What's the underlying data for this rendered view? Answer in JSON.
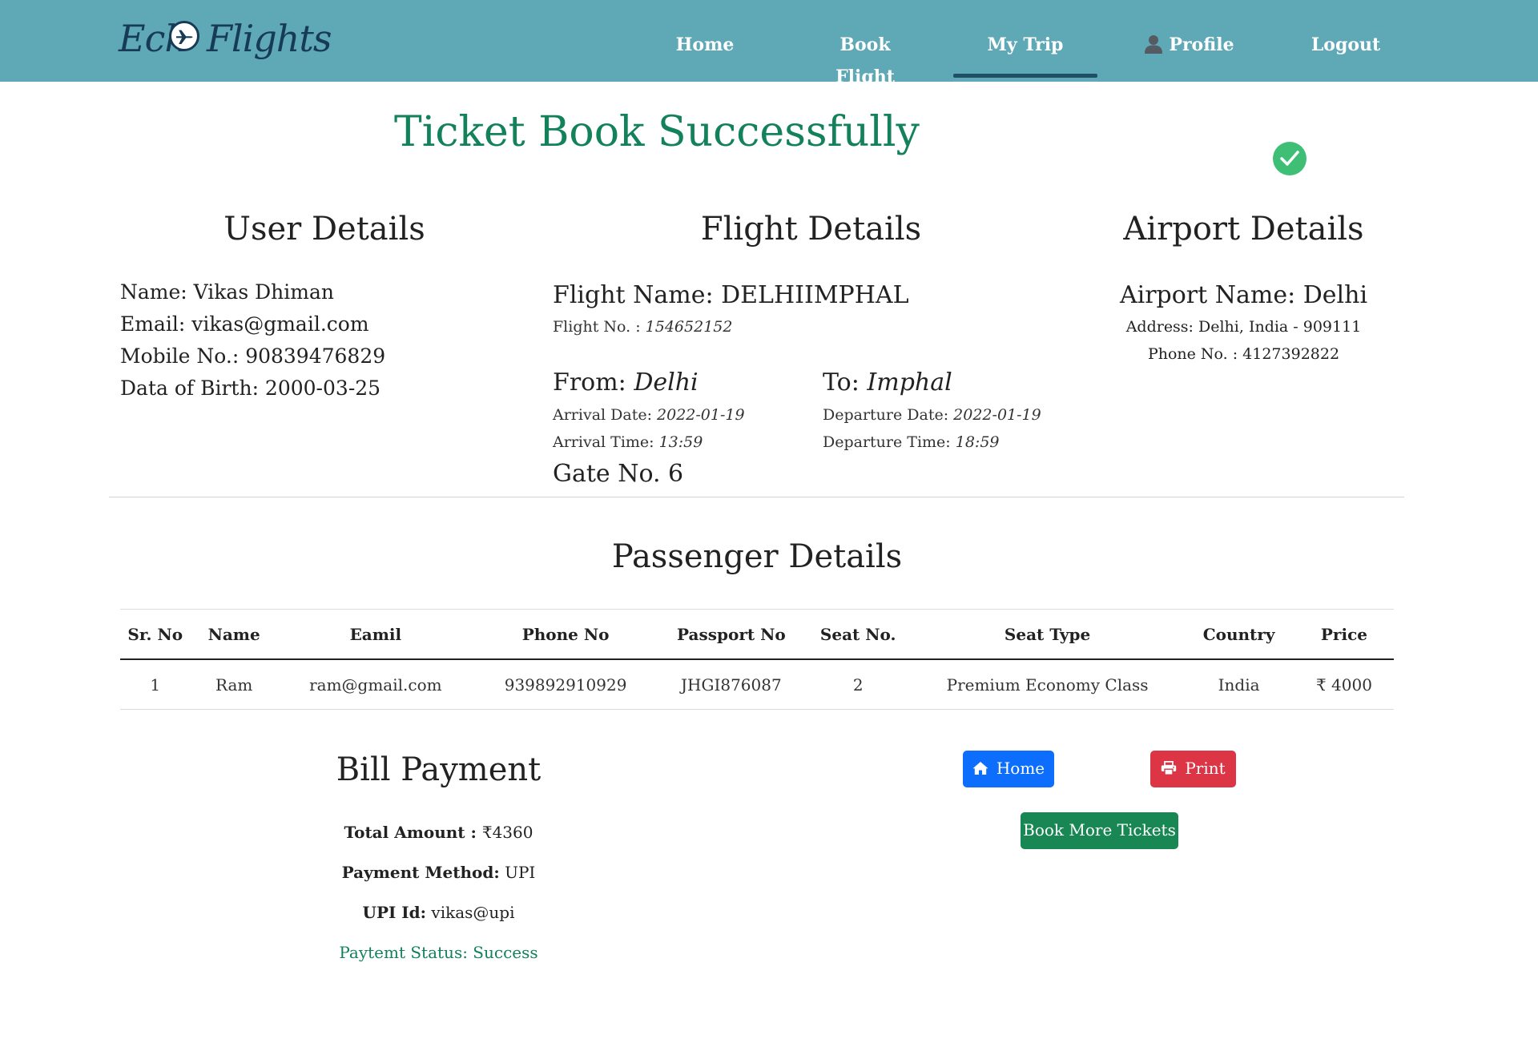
{
  "nav": {
    "logo_left": "Ech",
    "logo_right": "Flights",
    "items": [
      {
        "label": "Home"
      },
      {
        "label": "Book Flight"
      },
      {
        "label": "My Trip"
      },
      {
        "label": "Profile"
      },
      {
        "label": "Logout"
      }
    ],
    "active": "My Trip"
  },
  "title": "Ticket Book Successfully",
  "user": {
    "heading": "User Details",
    "name": "Name: Vikas Dhiman",
    "email": "Email: vikas@gmail.com",
    "mobile": "Mobile No.: 90839476829",
    "dob": "Data of Birth: 2000-03-25"
  },
  "flight": {
    "heading": "Flight Details",
    "name_label": "Flight Name: DELHIIMPHAL",
    "no_label": "Flight No. : ",
    "no_value": "154652152",
    "from_label": "From: ",
    "from_value": "Delhi",
    "to_label": "To: ",
    "to_value": "Imphal",
    "arrival_date_label": "Arrival Date: ",
    "arrival_date": "2022-01-19",
    "arrival_time_label": "Arrival Time: ",
    "arrival_time": "13:59",
    "departure_date_label": "Departure Date: ",
    "departure_date": "2022-01-19",
    "departure_time_label": "Departure Time: ",
    "departure_time": "18:59",
    "gate": "Gate No. 6"
  },
  "airport": {
    "heading": "Airport Details",
    "name": "Airport Name: Delhi",
    "address": "Address: Delhi, India - 909111",
    "phone": "Phone No. : 4127392822"
  },
  "passengers": {
    "heading": "Passenger Details",
    "columns": [
      "Sr. No",
      "Name",
      "Eamil",
      "Phone No",
      "Passport No",
      "Seat No.",
      "Seat Type",
      "Country",
      "Price"
    ],
    "rows": [
      {
        "sr": "1",
        "name": "Ram",
        "email": "ram@gmail.com",
        "phone": "939892910929",
        "passport": "JHGI876087",
        "seat": "2",
        "seat_type": "Premium Economy Class",
        "country": "India",
        "price": "₹ 4000"
      }
    ]
  },
  "bill": {
    "heading": "Bill Payment",
    "total_label": "Total Amount : ",
    "total_value": "₹4360",
    "method_label": "Payment Method:",
    "method_value": " UPI",
    "upi_label": "UPI Id:",
    "upi_value": " vikas@upi",
    "status": "Paytemt Status: Success"
  },
  "buttons": {
    "home": "Home",
    "print": "Print",
    "more": "Book More Tickets"
  },
  "colors": {
    "navbar": "#5fa8b6",
    "success": "#13815a",
    "home_btn": "#0d6efd",
    "print_btn": "#dc3545",
    "more_btn": "#198754"
  },
  "icons": {
    "logo": "airplane-icon",
    "success": "check-circle-icon",
    "profile": "user-icon",
    "home": "home-icon",
    "print": "print-icon"
  }
}
